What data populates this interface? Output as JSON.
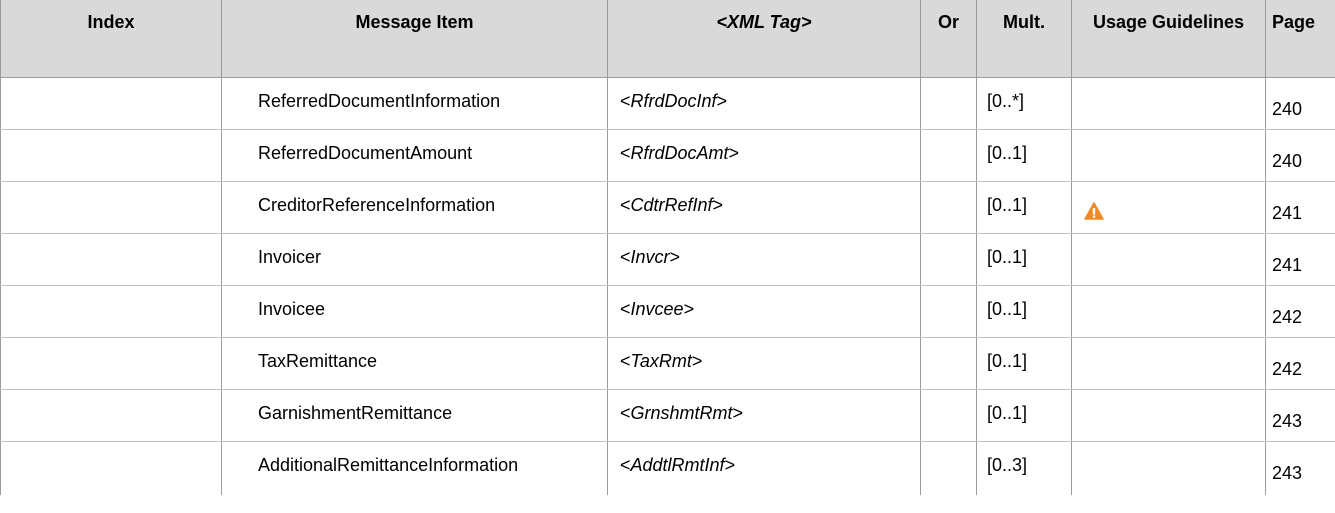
{
  "headers": {
    "index": "Index",
    "message_item": "Message Item",
    "xml_tag": "<XML Tag>",
    "or": "Or",
    "mult": "Mult.",
    "usage": "Usage Guidelines",
    "page": "Page"
  },
  "rows": [
    {
      "index": "",
      "item": "ReferredDocumentInformation",
      "tag": "RfrdDocInf",
      "or": "",
      "mult": "[0..*]",
      "usage_icon": "",
      "page": "240"
    },
    {
      "index": "",
      "item": "ReferredDocumentAmount",
      "tag": "RfrdDocAmt",
      "or": "",
      "mult": "[0..1]",
      "usage_icon": "",
      "page": "240"
    },
    {
      "index": "",
      "item": "CreditorReferenceInformation",
      "tag": "CdtrRefInf",
      "or": "",
      "mult": "[0..1]",
      "usage_icon": "warning-icon",
      "page": "241"
    },
    {
      "index": "",
      "item": "Invoicer",
      "tag": "Invcr",
      "or": "",
      "mult": "[0..1]",
      "usage_icon": "",
      "page": "241"
    },
    {
      "index": "",
      "item": "Invoicee",
      "tag": "Invcee",
      "or": "",
      "mult": "[0..1]",
      "usage_icon": "",
      "page": "242"
    },
    {
      "index": "",
      "item": "TaxRemittance",
      "tag": "TaxRmt",
      "or": "",
      "mult": "[0..1]",
      "usage_icon": "",
      "page": "242"
    },
    {
      "index": "",
      "item": "GarnishmentRemittance",
      "tag": "GrnshmtRmt",
      "or": "",
      "mult": "[0..1]",
      "usage_icon": "",
      "page": "243"
    },
    {
      "index": "",
      "item": "AdditionalRemittanceInformation",
      "tag": "AddtlRmtInf",
      "or": "",
      "mult": "[0..3]",
      "usage_icon": "",
      "page": "243"
    }
  ],
  "colors": {
    "header_bg": "#d9d9d9",
    "warning": "#f08a24"
  }
}
